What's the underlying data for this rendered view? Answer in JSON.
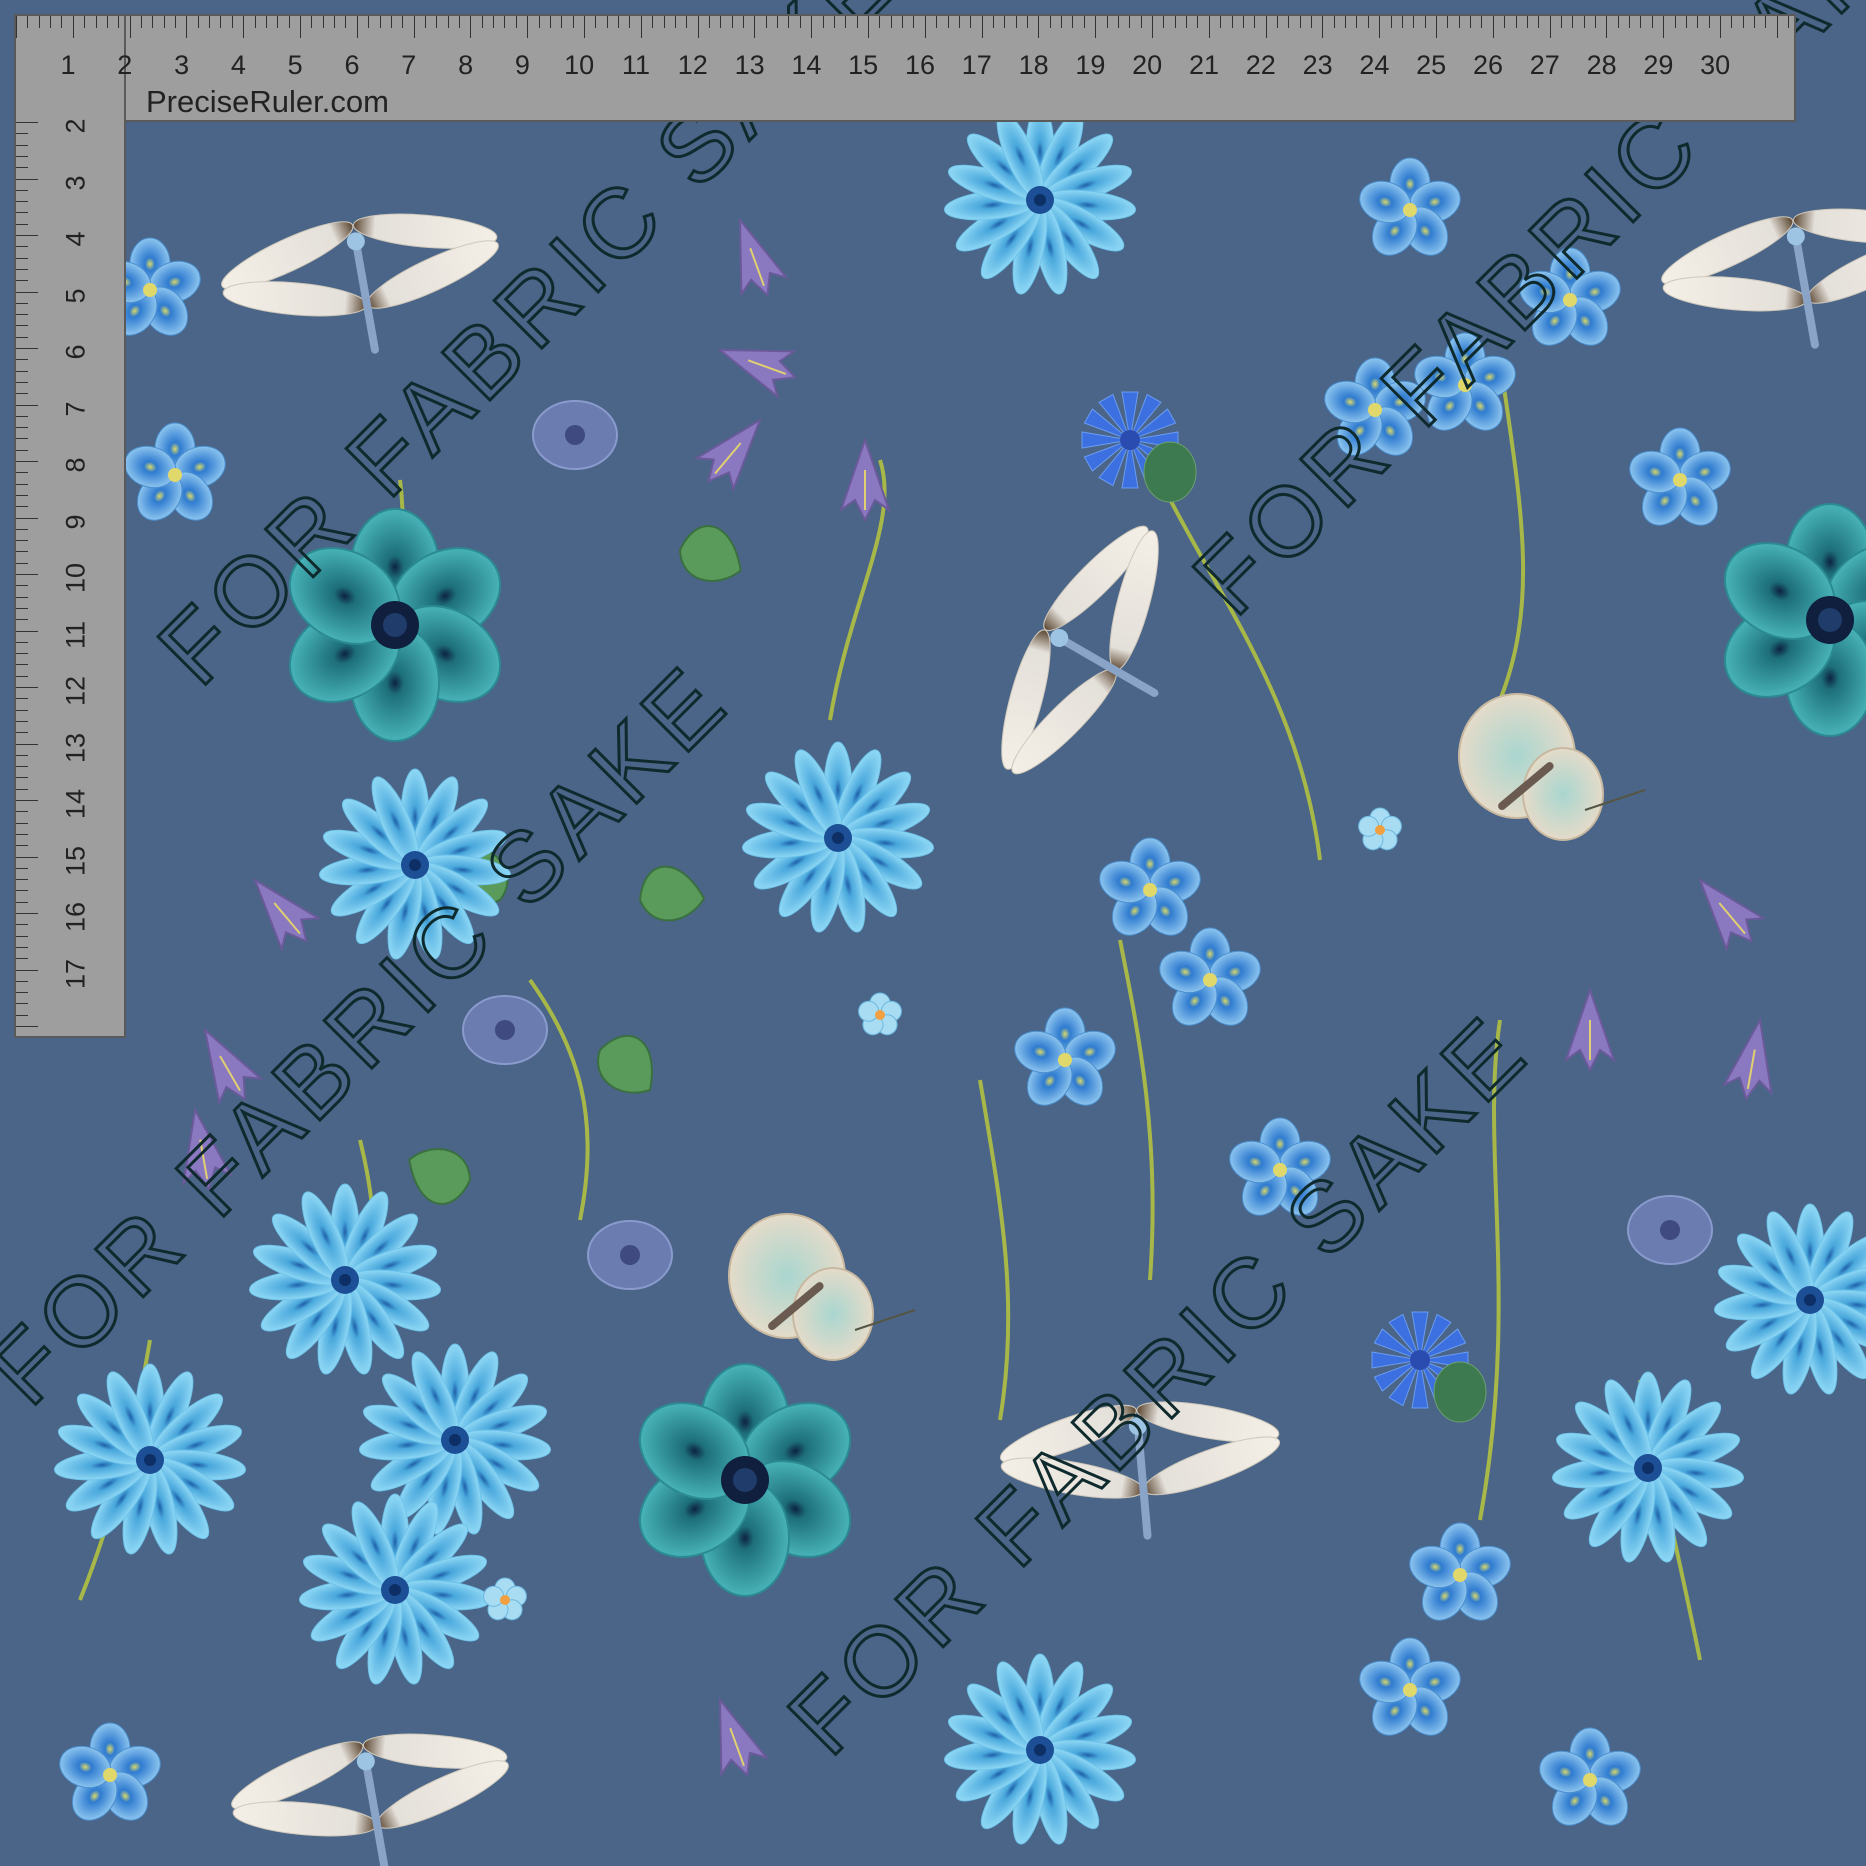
{
  "pattern": {
    "background_color": "#4a6587",
    "motifs": [
      "chicory-flower",
      "anemone-flower",
      "cornflower",
      "bellflower",
      "flax-flower",
      "forget-me-not",
      "dragonfly",
      "butterfly",
      "beetle",
      "morning-glory",
      "leaf"
    ]
  },
  "ruler": {
    "brand": "PreciseRuler.com",
    "horizontal_numbers": [
      "1",
      "2",
      "3",
      "4",
      "5",
      "6",
      "7",
      "8",
      "9",
      "10",
      "11",
      "12",
      "13",
      "14",
      "15",
      "16",
      "17",
      "18",
      "19",
      "20",
      "21",
      "22",
      "23",
      "24",
      "25",
      "26",
      "27",
      "28",
      "29",
      "30"
    ],
    "vertical_numbers": [
      "2",
      "3",
      "4",
      "5",
      "6",
      "7",
      "8",
      "9",
      "10",
      "11",
      "12",
      "13",
      "14",
      "15",
      "16",
      "17"
    ]
  },
  "watermark": {
    "lines": [
      "FOR FABRIC SAKE",
      "FOR FABRIC SAKE",
      "FOR FABRIC SAKE",
      "FOR FABRIC SAKE"
    ]
  }
}
